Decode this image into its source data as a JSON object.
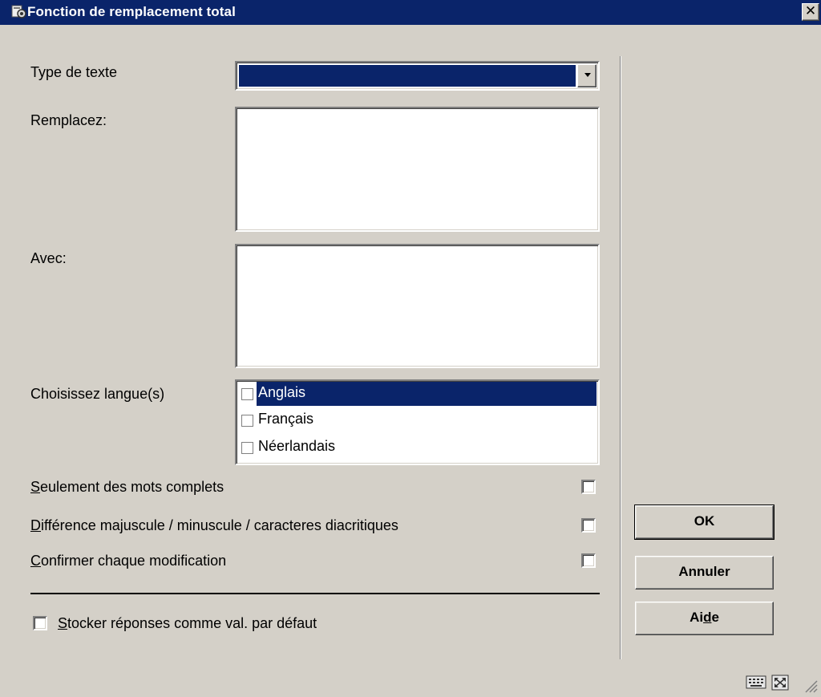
{
  "window": {
    "title": "Fonction de remplacement total",
    "close_glyph": "✕"
  },
  "form": {
    "type_label": "Type de texte",
    "type_value": "",
    "replace_label": "Remplacez:",
    "replace_value": "",
    "with_label": "Avec:",
    "with_value": "",
    "languages_label": "Choisissez langue(s)",
    "languages": [
      {
        "label": "Anglais",
        "checked": false,
        "selected": true
      },
      {
        "label": "Français",
        "checked": false,
        "selected": false
      },
      {
        "label": "Néerlandais",
        "checked": false,
        "selected": false
      }
    ]
  },
  "options": {
    "whole_words": {
      "hotkey": "S",
      "rest": "eulement des mots complets",
      "checked": false
    },
    "case_sensitive": {
      "hotkey": "D",
      "rest": "ifférence majuscule / minuscule / caracteres diacritiques",
      "checked": false
    },
    "confirm_each": {
      "hotkey": "C",
      "rest": "onfirmer chaque modification",
      "checked": false
    },
    "store_defaults": {
      "hotkey": "S",
      "rest": "tocker réponses comme val. par défaut",
      "checked": false
    }
  },
  "buttons": {
    "ok": "OK",
    "cancel": "Annuler",
    "help_pre": "Ai",
    "help_hotkey": "d",
    "help_post": "e"
  },
  "icons": {
    "title": "app-icon",
    "dropdown": "chevron-down-icon",
    "keyboard": "keyboard-icon",
    "maximize": "maximize-icon",
    "resize": "resize-grip-icon"
  }
}
